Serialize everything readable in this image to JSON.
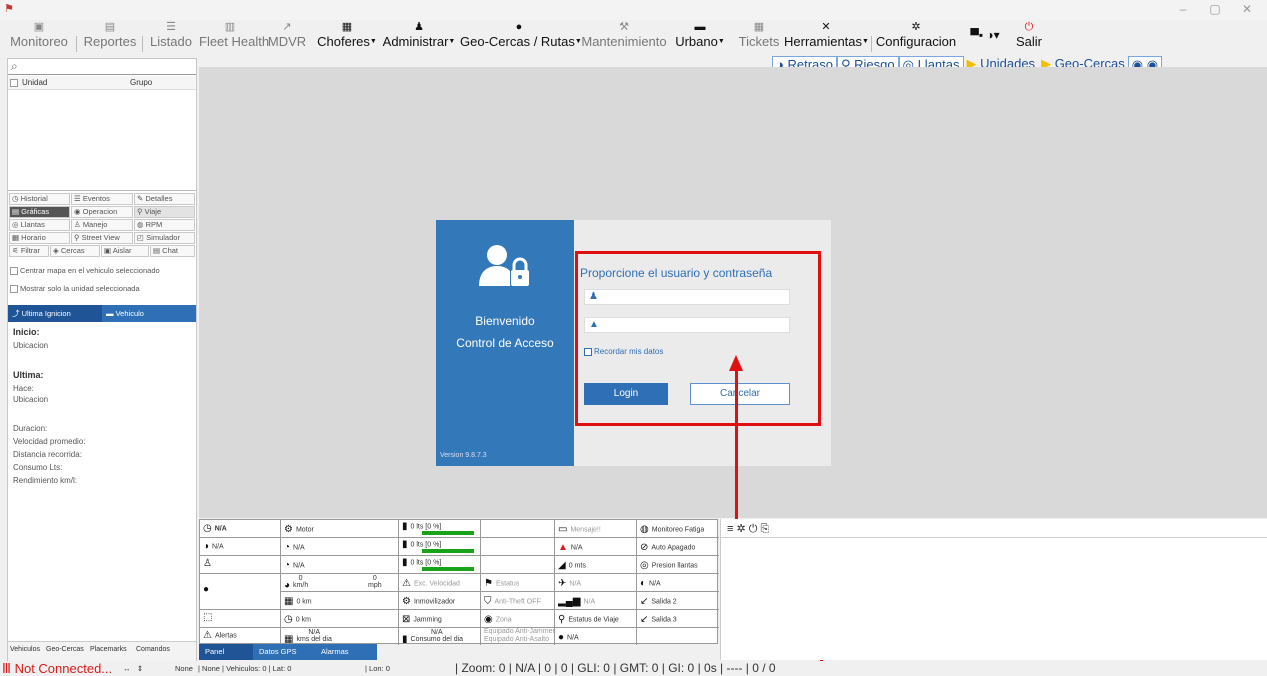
{
  "window": {
    "controls": [
      "–",
      "▢",
      "✕"
    ]
  },
  "menu": {
    "items": [
      {
        "label": "Monitoreo",
        "icon": "monitor-icon"
      },
      {
        "label": "Reportes",
        "icon": "report-icon"
      },
      {
        "label": "Listado",
        "icon": "list-icon"
      },
      {
        "label": "Fleet Health",
        "icon": "fleet-health-icon"
      },
      {
        "label": "MDVR",
        "icon": "mdvr-icon"
      },
      {
        "label": "Choferes",
        "icon": "driver-card-icon"
      },
      {
        "label": "Administrar",
        "icon": "admin-users-icon"
      },
      {
        "label": "Geo-Cercas / Rutas",
        "icon": "map-pin-icon"
      },
      {
        "label": "Mantenimiento",
        "icon": "wrench-icon"
      },
      {
        "label": "Urbano",
        "icon": "bus-icon"
      },
      {
        "label": "Tickets",
        "icon": "ticket-icon"
      },
      {
        "label": "Herramientas",
        "icon": "tools-icon"
      },
      {
        "label": "Configuracion",
        "icon": "gear-icon"
      },
      {
        "label": "Salir",
        "icon": "power-icon"
      }
    ]
  },
  "toolbar": {
    "retraso": "Retraso",
    "riesgo": "Riesgo",
    "llantas": "Llantas",
    "unidades": "Unidades",
    "geocercas": "Geo-Cercas"
  },
  "left_panel": {
    "grid_headers": [
      "Unidad",
      "Grupo"
    ],
    "buttons_row1": [
      "Historial",
      "Eventos",
      "Detalles"
    ],
    "buttons_row2": [
      "Gráficas",
      "Operacion",
      "Viaje"
    ],
    "buttons_row3": [
      "Llantas",
      "Manejo",
      "RPM"
    ],
    "buttons_row4": [
      "Horario",
      "Street View",
      "Simulador"
    ],
    "buttons_row5": [
      "Filtrar",
      "Cercas",
      "Aislar",
      "Chat"
    ],
    "check_center": "Centrar mapa en el vehiculo seleccionado",
    "check_only": "Mostrar solo la unidad seleccionada",
    "tab_ignition": "Ultima Ignicion",
    "tab_vehicle": "Vehiculo",
    "inicio": "Inicio:",
    "ubicacion1": "Ubicacion",
    "ultima": "Ultima:",
    "hace": "Hace:",
    "ubicacion2": "Ubicacion",
    "duracion": "Duracion:",
    "vel_prom": "Velocidad promedio:",
    "distancia": "Distancia recorrida:",
    "consumo": "Consumo Lts:",
    "rendimiento": "Rendimiento km/l:",
    "bottom_tabs": [
      "Vehiculos",
      "Geo-Cercas",
      "Placemarks",
      "Comandos"
    ]
  },
  "login": {
    "welcome": "Bienvenido",
    "control": "Control de Acceso",
    "version": "Version 9.8.7.3",
    "title": "Proporcione el usuario y contraseña",
    "user_value": "",
    "password_value": "",
    "remember": "Recordar mis datos",
    "login_btn": "Login",
    "cancel_btn": "Cancelar"
  },
  "status_grid": {
    "c1": [
      "N/A",
      "N/A",
      "",
      "",
      "",
      "",
      "Alertas"
    ],
    "motor": "Motor",
    "na1": "N/A",
    "na2": "N/A",
    "kmh0": "0",
    "kmh": "km/h",
    "mph0": "0",
    "mph": "mph",
    "km1": "0 km",
    "km2": "0 km",
    "kms_dia_na": "N/A",
    "kms_dia": "kms del dia",
    "fuel1": "0 lts [0 %]",
    "fuel2": "0 lts [0 %]",
    "fuel3": "0 lts [0 %]",
    "exc_vel": "Exc. Velocidad",
    "inmovilizador": "Inmovilizador",
    "jamming": "Jamming",
    "consumo_na": "N/A",
    "consumo_dia": "Consumo del dia",
    "estatus": "Estatus",
    "antitheft": "Anti-Theft OFF",
    "zona": "Zona",
    "jammer1": "Equipado Anti-Jammer",
    "jammer2": "Equipado Anti-Asalto",
    "mensaje": "Mensaje!!",
    "na_a": "N/A",
    "mts": "0 mts",
    "na_b": "N/A",
    "na_c": "N/A",
    "estatus_viaje": "Estatus de Viaje",
    "na_d": "N/A",
    "fatiga": "Monitoreo Fatiga",
    "auto_apagado": "Auto Apagado",
    "presion": "Presion llantas",
    "na_e": "N/A",
    "salida2": "Salida 2",
    "salida3": "Salida 3"
  },
  "panel_tabs": [
    "Panel",
    "Datos GPS",
    "Alarmas"
  ],
  "statusbar": {
    "connection": "Not Connected...",
    "none1": "None",
    "mid": "| None | Vehiculos: 0 | Lat: 0",
    "lon": "| Lon: 0",
    "zoom": "| Zoom: 0 | N/A | 0 | 0 | GLI: 0 | GMT: 0 | GI: 0 | 0s | ---- | 0 / 0"
  }
}
